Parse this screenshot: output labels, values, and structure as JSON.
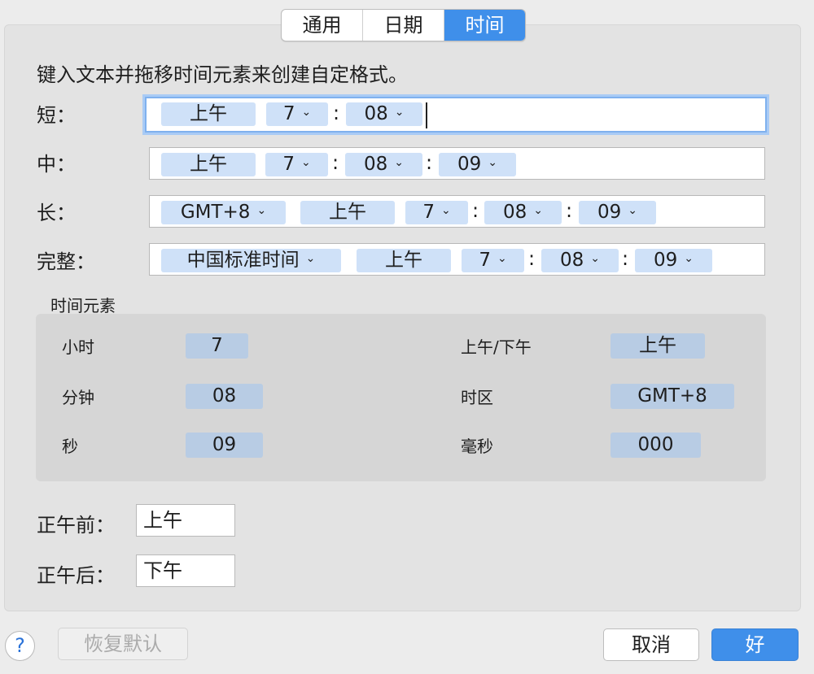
{
  "tabs": [
    "通用",
    "日期",
    "时间"
  ],
  "instruction": "键入文本并拖移时间元素来创建自定格式。",
  "formats": {
    "short": {
      "label": "短：",
      "tokens": [
        "上午",
        "7",
        "08"
      ],
      "seps": [
        ":"
      ]
    },
    "medium": {
      "label": "中：",
      "tokens": [
        "上午",
        "7",
        "08",
        "09"
      ],
      "seps": [
        ":",
        ":"
      ]
    },
    "long": {
      "label": "长：",
      "tokens": [
        "GMT+8",
        "上午",
        "7",
        "08",
        "09"
      ],
      "seps": [
        ":",
        ":"
      ]
    },
    "full": {
      "label": "完整：",
      "tokens": [
        "中国标准时间",
        "上午",
        "7",
        "08",
        "09"
      ],
      "seps": [
        ":",
        ":"
      ]
    }
  },
  "elements": {
    "title": "时间元素",
    "hour": {
      "label": "小时",
      "value": "7"
    },
    "minute": {
      "label": "分钟",
      "value": "08"
    },
    "second": {
      "label": "秒",
      "value": "09"
    },
    "ampm": {
      "label": "上午/下午",
      "value": "上午"
    },
    "timezone": {
      "label": "时区",
      "value": "GMT+8"
    },
    "millisecond": {
      "label": "毫秒",
      "value": "000"
    }
  },
  "before_noon": {
    "label": "正午前：",
    "value": "上午"
  },
  "after_noon": {
    "label": "正午后：",
    "value": "下午"
  },
  "buttons": {
    "help": "?",
    "restore": "恢复默认",
    "cancel": "取消",
    "ok": "好"
  },
  "chevron": "⌄"
}
